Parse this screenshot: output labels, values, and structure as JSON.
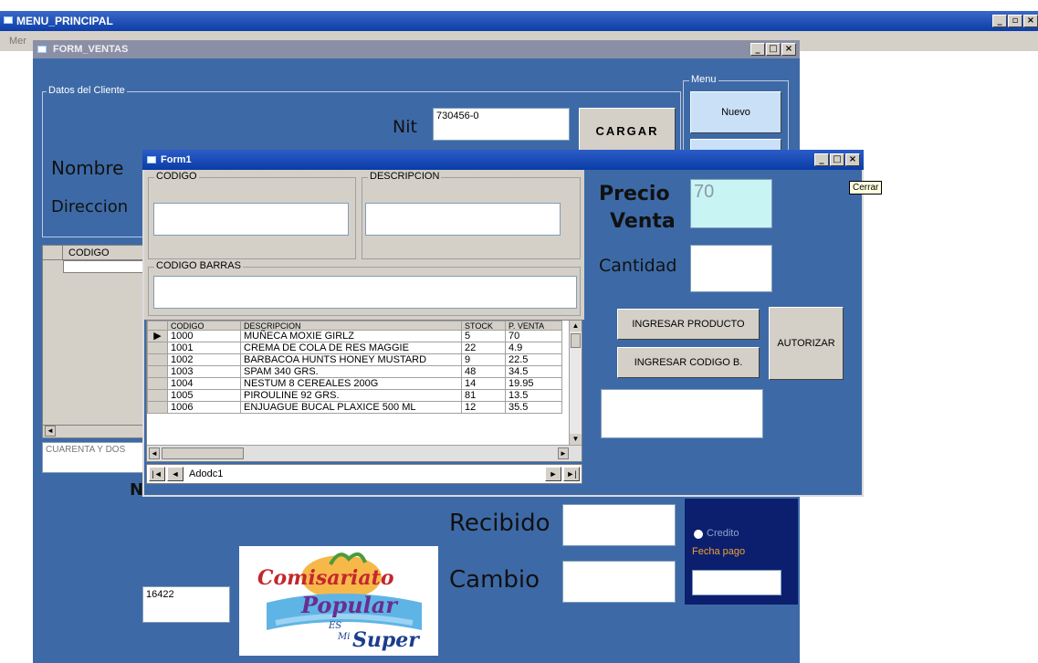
{
  "main_window": {
    "title": "MENU_PRINCIPAL",
    "menu_stub": "Mer"
  },
  "form_ventas": {
    "title": "FORM_VENTAS",
    "cliente_frame": "Datos del Cliente",
    "menu_frame": "Menu",
    "nit_label": "Nit",
    "nit_value": "730456-0",
    "nombre_label": "Nombre",
    "direccion_label": "Direccion",
    "nuevo_button": "Nuevo",
    "cargar_button": "CARGAR",
    "codigo_header": "CODIGO",
    "cantidad_letras": "CUARENTA Y DOS",
    "recibido_label": "Recibido",
    "cambio_label": "Cambio",
    "credito_label": "Credito",
    "fecha_pago_label": "Fecha pago",
    "number_field": "16422",
    "partial_label": "N",
    "logo_line1": "Comisariato",
    "logo_line2": "Popular",
    "logo_es": "ES",
    "logo_mi": "Mi",
    "logo_super": "Super"
  },
  "form1": {
    "title": "Form1",
    "codigo_frame": "CODIGO",
    "descripcion_frame": "DESCRIPCION",
    "codigo_barras_frame": "CODIGO BARRAS",
    "precio_label_line1": "Precio",
    "precio_label_line2": "Venta",
    "precio_value": "70",
    "cantidad_label": "Cantidad",
    "ingresar_producto_button": "INGRESAR PRODUCTO",
    "ingresar_codigo_button": "INGRESAR CODIGO B.",
    "autorizar_button": "AUTORIZAR",
    "adodc_caption": "Adodc1",
    "grid_headers": [
      "CODIGO",
      "DESCRIPCION",
      "STOCK",
      "P. VENTA"
    ],
    "grid_rows": [
      [
        "1000",
        "MUÑECA MOXIE GIRLZ",
        "5",
        "70"
      ],
      [
        "1001",
        "CREMA DE COLA DE RES MAGGIE",
        "22",
        "4.9"
      ],
      [
        "1002",
        "BARBACOA HUNTS HONEY MUSTARD",
        "9",
        "22.5"
      ],
      [
        "1003",
        "SPAM 340 GRS.",
        "48",
        "34.5"
      ],
      [
        "1004",
        "NESTUM 8 CEREALES 200G",
        "14",
        "19.95"
      ],
      [
        "1005",
        "PIROULINE 92 GRS.",
        "81",
        "13.5"
      ],
      [
        "1006",
        "ENJUAGUE BUCAL PLAXICE 500 ML",
        "12",
        "35.5"
      ]
    ]
  },
  "tooltip": {
    "text": "Cerrar"
  }
}
